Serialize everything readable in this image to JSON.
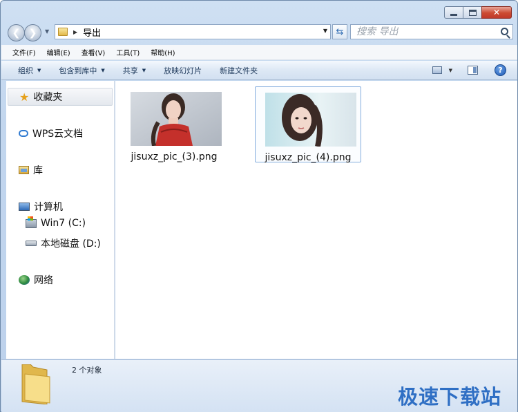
{
  "window": {
    "minimize_icon": "minimize-icon",
    "maximize_icon": "maximize-icon",
    "close_label": "✕"
  },
  "navigation": {
    "back_icon": "back-arrow-icon",
    "forward_icon": "forward-arrow-icon",
    "address_crumb": "导出",
    "refresh_icon": "refresh-icon",
    "search_placeholder": "搜索 导出"
  },
  "menubar": {
    "items": [
      "文件(F)",
      "编辑(E)",
      "查看(V)",
      "工具(T)",
      "帮助(H)"
    ]
  },
  "commandbar": {
    "organize": "组织",
    "include_in_library": "包含到库中",
    "share": "共享",
    "slideshow": "放映幻灯片",
    "new_folder": "新建文件夹",
    "help_label": "?"
  },
  "sidebar": {
    "items": [
      {
        "label": "收藏夹",
        "icon": "star-icon"
      },
      {
        "label": "WPS云文档",
        "icon": "cloud-icon"
      },
      {
        "label": "库",
        "icon": "library-icon"
      },
      {
        "label": "计算机",
        "icon": "computer-icon"
      },
      {
        "label": "Win7 (C:)",
        "icon": "drive-c-icon"
      },
      {
        "label": "本地磁盘 (D:)",
        "icon": "drive-d-icon"
      },
      {
        "label": "网络",
        "icon": "network-icon"
      }
    ]
  },
  "files": [
    {
      "name": "jisuxz_pic_(3).png",
      "selected": false
    },
    {
      "name": "jisuxz_pic_(4).png",
      "selected": true
    }
  ],
  "status": {
    "count": "2 个对象",
    "watermark": "极速下载站"
  },
  "colors": {
    "accent": "#2f6fc4",
    "close_button": "#c0392b",
    "selection_border": "#84acdd"
  }
}
